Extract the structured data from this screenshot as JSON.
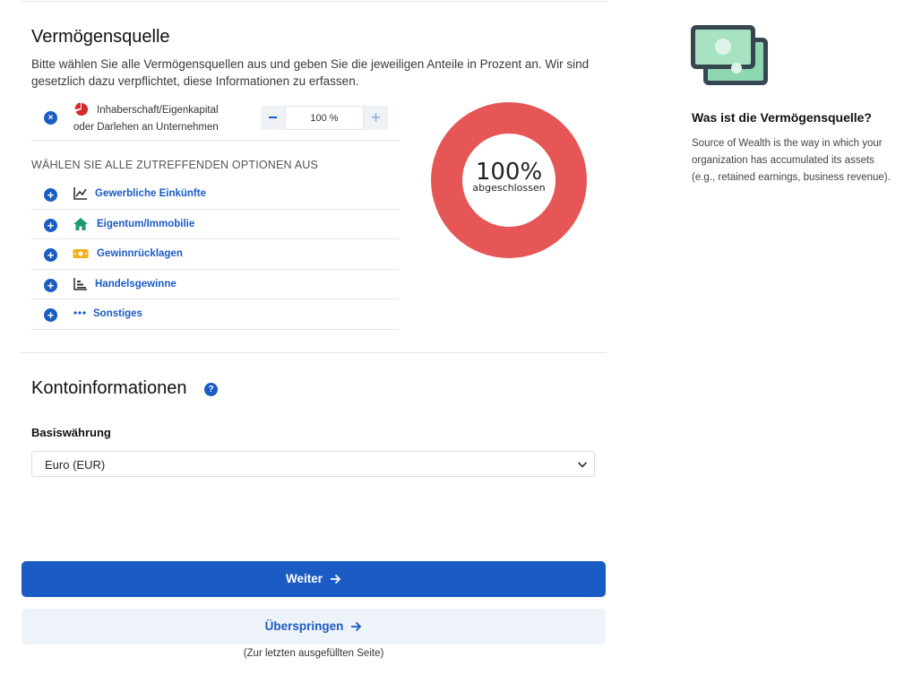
{
  "wealth_source": {
    "title": "Vermögensquelle",
    "description": "Bitte wählen Sie alle Vermögensquellen aus und geben Sie die jeweiligen Anteile in Prozent an. Wir sind gesetzlich dazu verpflichtet, diese Informationen zu erfassen.",
    "selected": {
      "label_line1": "Inhaberschaft/Eigenkapital",
      "label_line2": "oder Darlehen an Unternehmen",
      "percent_value": "100 %",
      "icon": "pie-chart-icon",
      "remove_symbol": "×",
      "minus_symbol": "−",
      "plus_symbol": "+"
    },
    "options_heading": "WÄHLEN SIE ALLE ZUTREFFENDEN OPTIONEN AUS",
    "options": [
      {
        "label": "Gewerbliche Einkünfte",
        "icon": "line-chart-icon"
      },
      {
        "label": "Eigentum/Immobilie",
        "icon": "house-icon"
      },
      {
        "label": "Gewinnrücklagen",
        "icon": "cash-icon"
      },
      {
        "label": "Handelsgewinne",
        "icon": "bar-chart-icon"
      },
      {
        "label": "Sonstiges",
        "icon": "more-dots-icon"
      }
    ],
    "donut": {
      "percent": "100%",
      "label": "abgeschlossen",
      "completion": 1.0,
      "color": "#e65656"
    }
  },
  "account_info": {
    "title": "Kontoinformationen",
    "help_symbol": "?",
    "base_currency_label": "Basiswährung",
    "base_currency_value": "Euro (EUR)"
  },
  "actions": {
    "next_label": "Weiter",
    "skip_label": "Überspringen",
    "skip_note": "(Zur letzten ausgefüllten Seite)"
  },
  "sidebar": {
    "title": "Was ist die Vermögensquelle?",
    "text": "Source of Wealth is the way in which your organization has accumulated its assets (e.g., retained earnings, business revenue).",
    "illustration": "money-bills-icon"
  },
  "colors": {
    "primary": "#1a5bc4",
    "donut": "#e65656",
    "house_icon": "#1d9a74",
    "cash_icon": "#f2b01e",
    "pie_icon": "#d62a2a"
  }
}
